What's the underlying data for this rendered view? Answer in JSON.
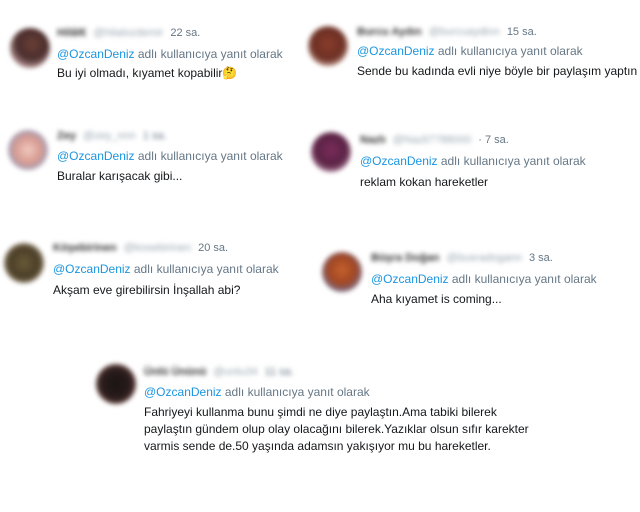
{
  "reply_prefix": "@OzcanDeniz",
  "reply_suffix": " adlı kullanıcıya yanıt olarak",
  "tweets": [
    {
      "name": "Hilâl€",
      "handle": "@hilalozdemir",
      "time": "22 sa.",
      "text": "Bu iyi olmadı, kıyamet kopabilir",
      "emoji": "🤔"
    },
    {
      "name": "Burcu Aydın",
      "handle": "@burcuaydinn",
      "time": "15 sa.",
      "text": "Sende bu kadında evli niye böyle bir paylaşım yaptın şimdi"
    },
    {
      "name": "Zey",
      "handle": "@zey_nnn",
      "time": "1 sa.",
      "text": "Buralar karışacak gibi..."
    },
    {
      "name": "Nazlı",
      "handle": "@Nazli7788000",
      "time": "· 7 sa.",
      "text": "reklam kokan hareketler"
    },
    {
      "name": "Köşebirinen",
      "handle": "@kosebirinen",
      "time": "20 sa.",
      "text": "Akşam eve girebilirsin İnşallah abi?"
    },
    {
      "name": "Büşra Doğan",
      "handle": "@busradogann",
      "time": "3 sa.",
      "text": "Aha kıyamet is coming..."
    },
    {
      "name": "Ünlü Ününü",
      "handle": "@unlu34",
      "time": "11 sa.",
      "text": "Fahriyeyi  kullanma bunu şimdi ne diye paylaştın.Ama tabiki bilerek paylaştın gündem olup olay olacağını bilerek.Yazıklar olsun sıfır karekter varmis sende de.50 yaşında adamsın yakışıyor mu bu hareketler."
    }
  ],
  "colors": {
    "mention": "#1b95e0",
    "muted": "#657786",
    "text": "#14171a"
  }
}
